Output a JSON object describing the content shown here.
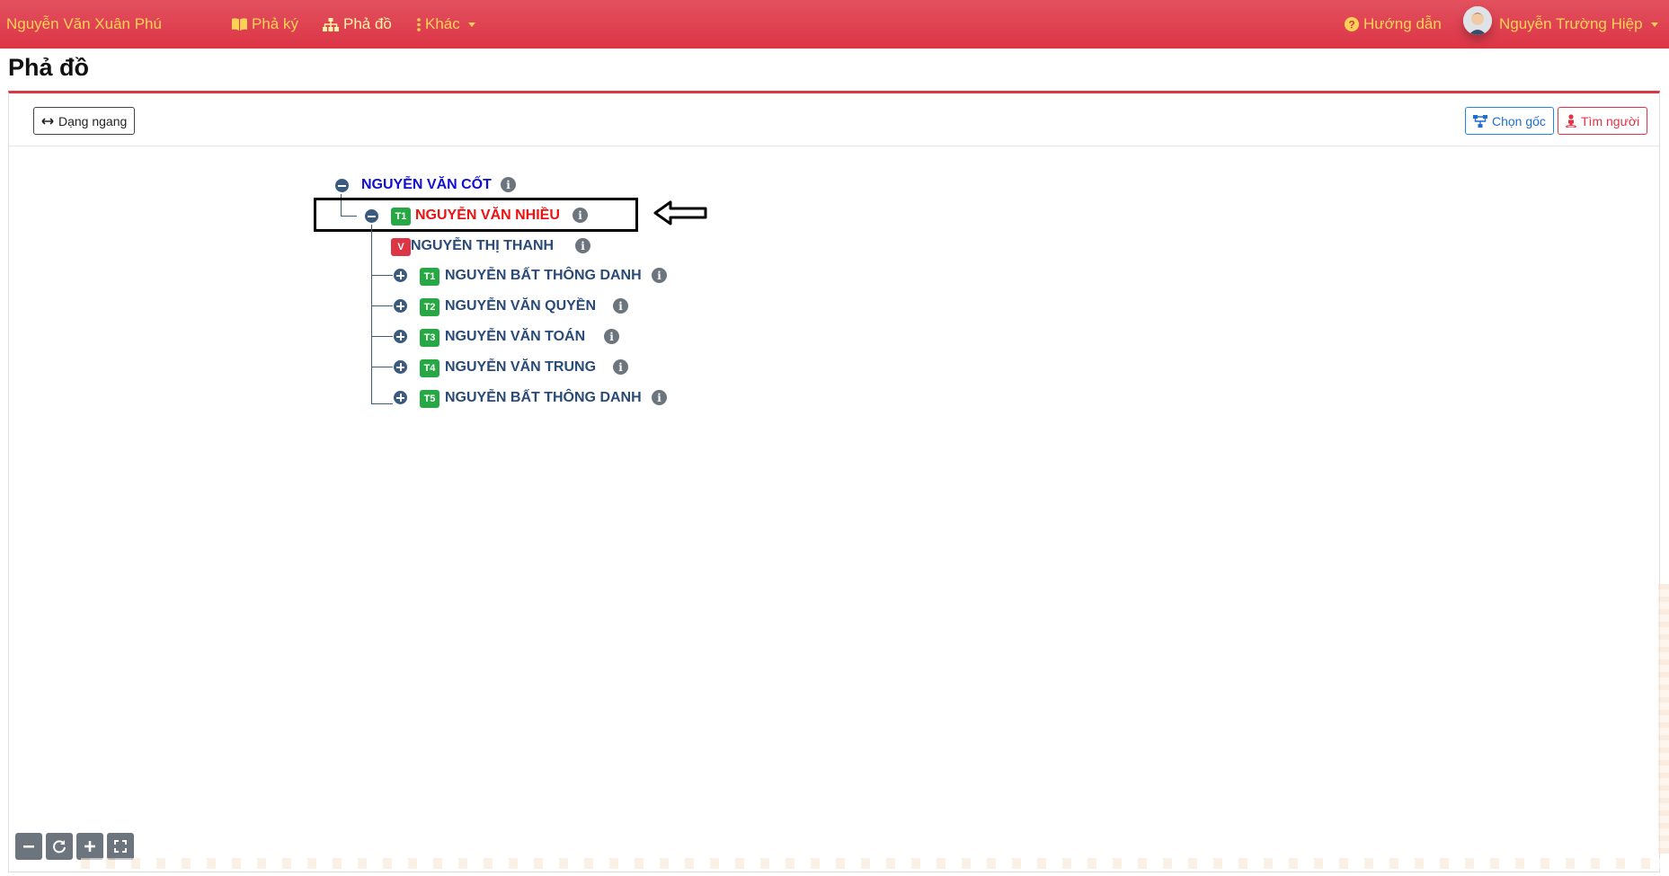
{
  "navbar": {
    "brand": "Nguyễn Văn Xuân Phú",
    "items": [
      {
        "label": "Phả ký",
        "icon": "book-open-icon"
      },
      {
        "label": "Phả đồ",
        "icon": "sitemap-icon",
        "active": true
      },
      {
        "label": "Khác",
        "icon": "ellipsis-vertical-icon"
      }
    ],
    "help": "Hướng dẫn",
    "user": "Nguyễn Trường Hiệp"
  },
  "page": {
    "title": "Phả đồ"
  },
  "toolbar": {
    "horizontal": "Dạng ngang",
    "choose_root": "Chọn gốc",
    "find_person": "Tìm người"
  },
  "tree": {
    "root": {
      "name": "NGUYỄN VĂN CỐT"
    },
    "child": {
      "badge": "T1",
      "name": "NGUYỄN VĂN NHIỀU"
    },
    "spouse": {
      "badge": "V",
      "name": "NGUYỄN THỊ THANH"
    },
    "grandchildren": [
      {
        "badge": "T1",
        "name": "NGUYỄN BẤT THÔNG DANH"
      },
      {
        "badge": "T2",
        "name": "NGUYỄN VĂN QUYỀN"
      },
      {
        "badge": "T3",
        "name": "NGUYỄN VĂN TOÁN"
      },
      {
        "badge": "T4",
        "name": "NGUYỄN VĂN TRUNG"
      },
      {
        "badge": "T5",
        "name": "NGUYỄN BẤT THÔNG DANH"
      }
    ]
  },
  "colors": {
    "navbar": "#dc3545",
    "nav_text": "#ffd257",
    "root_name": "#1010d0",
    "selected_name": "#ee1111",
    "node_name": "#2a4a78",
    "badge_green": "#28a745",
    "badge_red": "#dc3545"
  }
}
